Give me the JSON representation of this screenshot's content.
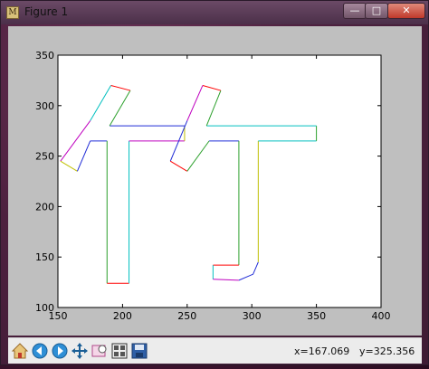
{
  "window": {
    "title": "Figure 1",
    "icon": "matplotlib-app-icon",
    "controls": {
      "minimize": "—",
      "maximize": "□",
      "close": "✕"
    }
  },
  "toolbar": {
    "buttons": [
      {
        "name": "home-icon"
      },
      {
        "name": "back-icon"
      },
      {
        "name": "forward-icon"
      },
      {
        "name": "pan-icon"
      },
      {
        "name": "zoom-icon"
      },
      {
        "name": "subplots-icon"
      },
      {
        "name": "save-icon"
      }
    ],
    "x_readout": "x=167.069",
    "y_readout": "y=325.356"
  },
  "chart_data": {
    "type": "line",
    "title": "",
    "xlabel": "",
    "ylabel": "",
    "xlim": [
      150,
      400
    ],
    "ylim": [
      100,
      350
    ],
    "xticks": [
      "150",
      "200",
      "250",
      "300",
      "350",
      "400"
    ],
    "yticks": [
      "100",
      "150",
      "200",
      "250",
      "300",
      "350"
    ],
    "grid": false,
    "series": [
      {
        "color": "#1f2bd6",
        "points": [
          [
            175,
            265
          ],
          [
            188,
            265
          ]
        ]
      },
      {
        "color": "#2ca02c",
        "points": [
          [
            188,
            265
          ],
          [
            188,
            124
          ]
        ]
      },
      {
        "color": "#ff0000",
        "points": [
          [
            188,
            124
          ],
          [
            205,
            124
          ]
        ]
      },
      {
        "color": "#00bfbf",
        "points": [
          [
            205,
            124
          ],
          [
            205,
            265
          ]
        ]
      },
      {
        "color": "#bf00bf",
        "points": [
          [
            205,
            265
          ],
          [
            248,
            265
          ]
        ]
      },
      {
        "color": "#bfbf00",
        "points": [
          [
            248,
            265
          ],
          [
            248,
            280
          ]
        ]
      },
      {
        "color": "#1f2bd6",
        "points": [
          [
            248,
            280
          ],
          [
            190,
            280
          ]
        ]
      },
      {
        "color": "#2ca02c",
        "points": [
          [
            190,
            280
          ],
          [
            206,
            315
          ]
        ]
      },
      {
        "color": "#ff0000",
        "points": [
          [
            206,
            315
          ],
          [
            191,
            320
          ]
        ]
      },
      {
        "color": "#00bfbf",
        "points": [
          [
            191,
            320
          ],
          [
            175,
            285
          ]
        ]
      },
      {
        "color": "#bf00bf",
        "points": [
          [
            175,
            285
          ],
          [
            152,
            245
          ]
        ]
      },
      {
        "color": "#bfbf00",
        "points": [
          [
            152,
            245
          ],
          [
            165,
            235
          ]
        ]
      },
      {
        "color": "#1f2bd6",
        "points": [
          [
            165,
            235
          ],
          [
            175,
            265
          ]
        ]
      },
      {
        "color": "#1f2bd6",
        "points": [
          [
            267,
            265
          ],
          [
            290,
            265
          ]
        ]
      },
      {
        "color": "#2ca02c",
        "points": [
          [
            290,
            265
          ],
          [
            290,
            142
          ]
        ]
      },
      {
        "color": "#ff0000",
        "points": [
          [
            290,
            142
          ],
          [
            270,
            142
          ]
        ]
      },
      {
        "color": "#00bfbf",
        "points": [
          [
            270,
            142
          ],
          [
            270,
            128
          ]
        ]
      },
      {
        "color": "#bf00bf",
        "points": [
          [
            270,
            128
          ],
          [
            290,
            127
          ]
        ]
      },
      {
        "color": "#1f2bd6",
        "points": [
          [
            290,
            127
          ],
          [
            301,
            133
          ],
          [
            305,
            145
          ]
        ]
      },
      {
        "color": "#bfbf00",
        "points": [
          [
            305,
            145
          ],
          [
            305,
            265
          ]
        ]
      },
      {
        "color": "#00bfbf",
        "points": [
          [
            305,
            265
          ],
          [
            350,
            265
          ]
        ]
      },
      {
        "color": "#2ca02c",
        "points": [
          [
            350,
            265
          ],
          [
            350,
            280
          ]
        ]
      },
      {
        "color": "#00bfbf",
        "points": [
          [
            350,
            280
          ],
          [
            265,
            280
          ]
        ]
      },
      {
        "color": "#2ca02c",
        "points": [
          [
            265,
            280
          ],
          [
            276,
            315
          ]
        ]
      },
      {
        "color": "#ff0000",
        "points": [
          [
            276,
            315
          ],
          [
            262,
            320
          ]
        ]
      },
      {
        "color": "#bf00bf",
        "points": [
          [
            262,
            320
          ],
          [
            250,
            285
          ]
        ]
      },
      {
        "color": "#1f2bd6",
        "points": [
          [
            250,
            285
          ],
          [
            237,
            245
          ]
        ]
      },
      {
        "color": "#ff0000",
        "points": [
          [
            237,
            245
          ],
          [
            250,
            235
          ]
        ]
      },
      {
        "color": "#2ca02c",
        "points": [
          [
            250,
            235
          ],
          [
            267,
            265
          ]
        ]
      }
    ]
  }
}
